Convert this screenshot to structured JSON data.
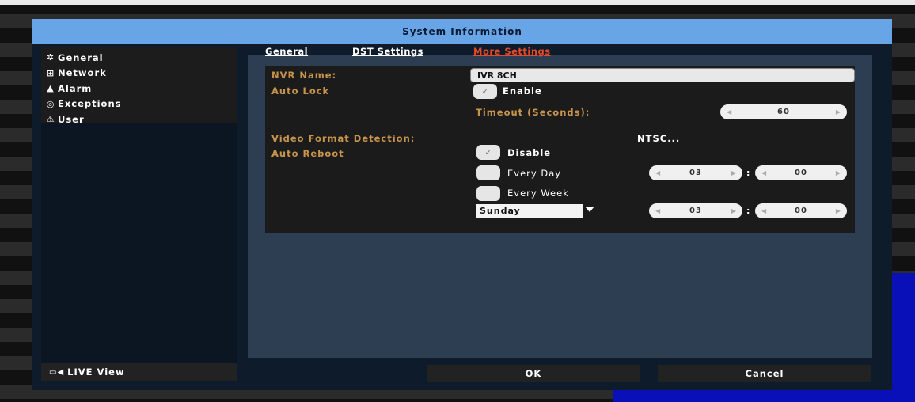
{
  "window": {
    "title": "System Information"
  },
  "sidebar": {
    "items": [
      {
        "icon": "gear-icon",
        "glyph": "✲",
        "label": "General"
      },
      {
        "icon": "network-icon",
        "glyph": "⊞",
        "label": "Network"
      },
      {
        "icon": "bell-icon",
        "glyph": "▲",
        "label": "Alarm"
      },
      {
        "icon": "eye-icon",
        "glyph": "◎",
        "label": "Exceptions"
      },
      {
        "icon": "warning-icon",
        "glyph": "⚠",
        "label": "User"
      }
    ],
    "live_view": {
      "glyph": "▭◀",
      "label": "LIVE View"
    }
  },
  "tabs": [
    {
      "label": "General",
      "active": false
    },
    {
      "label": "DST Settings",
      "active": false
    },
    {
      "label": "More Settings",
      "active": true
    }
  ],
  "colors": {
    "active_tab": "#e24a2a",
    "label": "#c8934a",
    "title_bar": "#68a5e6"
  },
  "form": {
    "nvr_name_label": "NVR Name:",
    "nvr_name_value": "IVR 8CH",
    "auto_lock_label": "Auto Lock",
    "auto_lock_enable": "Enable",
    "timeout_label": "Timeout (Seconds):",
    "timeout_value": "60",
    "video_format_label": "Video Format Detection:",
    "video_format_value": "NTSC...",
    "auto_reboot_label": "Auto Reboot",
    "reboot_disable": "Disable",
    "reboot_every_day": "Every Day",
    "reboot_every_week": "Every Week",
    "day_hour": "03",
    "day_minute": "00",
    "week_day": "Sunday",
    "week_hour": "03",
    "week_minute": "00",
    "colon": ":"
  },
  "buttons": {
    "ok": "OK",
    "cancel": "Cancel"
  }
}
